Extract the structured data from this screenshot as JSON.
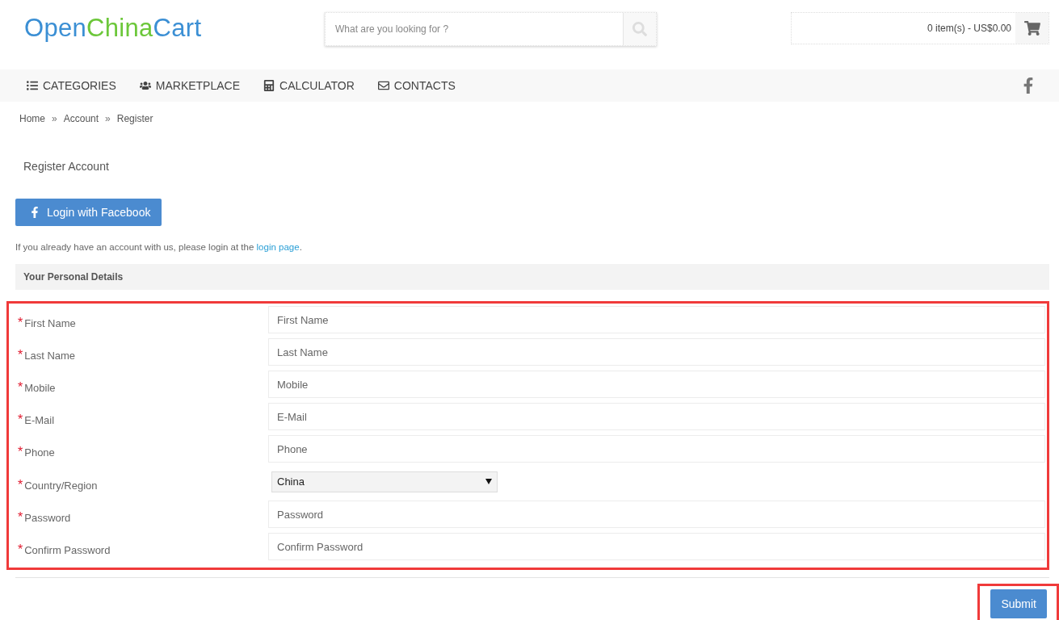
{
  "logo": {
    "parts": [
      "Open",
      "China",
      "Cart"
    ]
  },
  "search": {
    "placeholder": "What are you looking for ?"
  },
  "cart": {
    "summary": "0 item(s) - US$0.00"
  },
  "nav": [
    {
      "label": "CATEGORIES",
      "kind": "list"
    },
    {
      "label": "MARKETPLACE",
      "kind": "users"
    },
    {
      "label": "CALCULATOR",
      "kind": "calculator"
    },
    {
      "label": "CONTACTS",
      "kind": "mail"
    }
  ],
  "breadcrumb": [
    "Home",
    "Account",
    "Register"
  ],
  "breadcrumb_separator": "»",
  "title": "Register Account",
  "facebook_button": "Login with Facebook",
  "login_note": {
    "text": "If you already have an account with us, please login at the ",
    "link": "login page",
    "end": "."
  },
  "section": "Your Personal Details",
  "form": {
    "highlighted": true,
    "required_mark": "*",
    "fields": [
      {
        "label": "First Name",
        "kind": "text",
        "placeholder": "First Name",
        "required": true
      },
      {
        "label": "Last Name",
        "kind": "text",
        "placeholder": "Last Name",
        "required": true
      },
      {
        "label": "Mobile",
        "kind": "text",
        "placeholder": "Mobile",
        "required": true
      },
      {
        "label": "E-Mail",
        "kind": "text",
        "placeholder": "E-Mail",
        "required": true
      },
      {
        "label": "Phone",
        "kind": "text",
        "placeholder": "Phone",
        "required": true
      },
      {
        "label": "Country/Region",
        "kind": "select",
        "value": "China",
        "required": true
      },
      {
        "label": "Password",
        "kind": "text",
        "placeholder": "Password",
        "required": true
      },
      {
        "label": "Confirm Password",
        "kind": "text",
        "placeholder": "Confirm Password",
        "required": true
      }
    ]
  },
  "submit": {
    "label": "Submit",
    "highlighted": true
  }
}
